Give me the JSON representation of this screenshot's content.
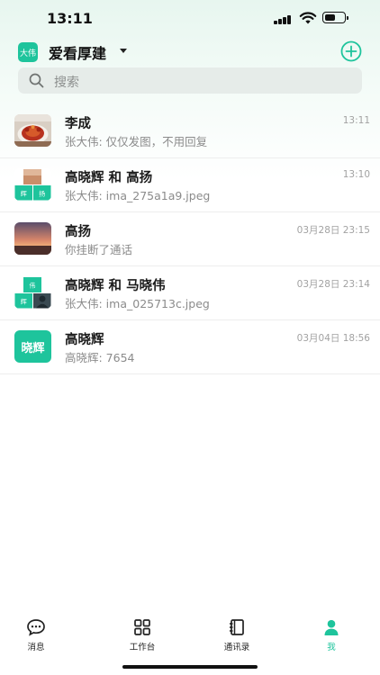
{
  "status_bar": {
    "time": "13:11",
    "battery_level": 0.55
  },
  "header": {
    "org_logo_text": "大伟",
    "org_name": "爱看厚建",
    "add_icon": "plus-circle-icon"
  },
  "search": {
    "placeholder": "搜索",
    "icon": "search-icon"
  },
  "conversations": [
    {
      "name": "李成",
      "message": "张大伟: 仅仅发图，不用回复",
      "time": "13:11",
      "avatar": "food-photo"
    },
    {
      "name": "高晓辉 和 高扬",
      "message": "张大伟: ima_275a1a9.jpeg",
      "time": "13:10",
      "avatar": "group-avatar",
      "avatar_tiles": [
        "辉",
        "扬"
      ]
    },
    {
      "name": "高扬",
      "message": "你挂断了通话",
      "time": "03月28日 23:15",
      "avatar": "sunset-photo"
    },
    {
      "name": "高晓辉 和 马晓伟",
      "message": "张大伟: ima_025713c.jpeg",
      "time": "03月28日 23:14",
      "avatar": "group-avatar",
      "avatar_tiles": [
        "伟",
        "辉"
      ]
    },
    {
      "name": "高晓辉",
      "message": "高晓辉: 7654",
      "time": "03月04日 18:56",
      "avatar": "text-avatar",
      "avatar_text": "晓辉"
    }
  ],
  "tabbar": {
    "tabs": [
      {
        "label": "消息",
        "icon": "chat-bubble-icon",
        "active": false
      },
      {
        "label": "工作台",
        "icon": "grid-icon",
        "active": false
      },
      {
        "label": "通讯录",
        "icon": "contacts-book-icon",
        "active": false
      },
      {
        "label": "我",
        "icon": "person-icon",
        "active": true
      }
    ]
  },
  "colors": {
    "accent": "#1ec49c",
    "header_gradient_top": "#e7f6ef",
    "search_bg": "#e6ece9"
  }
}
